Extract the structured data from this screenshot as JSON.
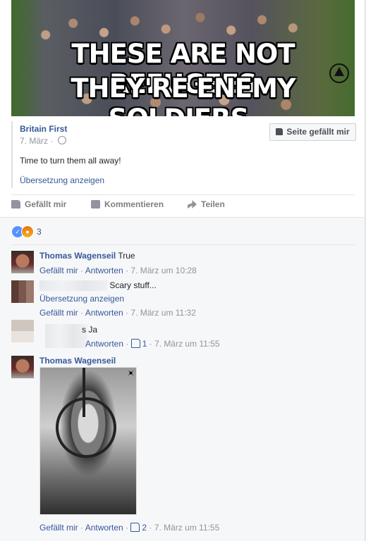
{
  "shared_image": {
    "line1": "THESE ARE NOT REFUGEES",
    "line2": "THEY'RE ENEMY SOLDIERS."
  },
  "post": {
    "page_name": "Britain First",
    "date": "7. März",
    "like_page_label": "Seite gefällt mir",
    "text": "Time to turn them all away!",
    "translate_label": "Übersetzung anzeigen"
  },
  "actions": {
    "like": "Gefällt mir",
    "comment": "Kommentieren",
    "share": "Teilen"
  },
  "reactions": {
    "count": "3"
  },
  "comments": [
    {
      "author": "Thomas Wagenseil",
      "text": "True",
      "like": "Gefällt mir",
      "reply": "Antworten",
      "time": "7. März um 10:28"
    },
    {
      "author": "",
      "text": "Scary stuff...",
      "translate": "Übersetzung anzeigen",
      "like": "Gefällt mir",
      "reply": "Antworten",
      "time": "7. März um 11:32"
    },
    {
      "author": "",
      "text": "s Ja",
      "reply": "Antworten",
      "likes": "1",
      "time": "7. März um 11:55"
    },
    {
      "author": "Thomas Wagenseil",
      "like": "Gefällt mir",
      "reply": "Antworten",
      "likes": "2",
      "time": "7. März um 11:55"
    }
  ],
  "separator": "·"
}
